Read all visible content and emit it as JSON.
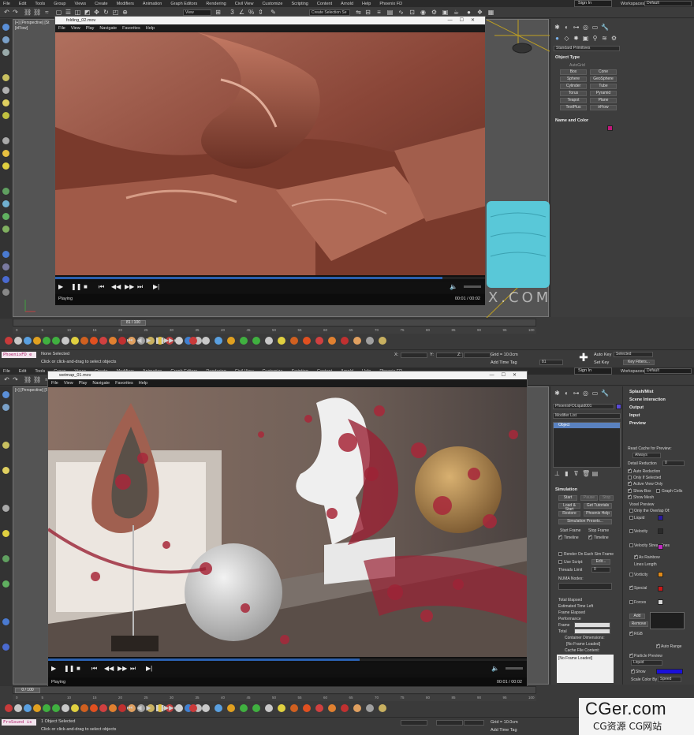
{
  "menu": [
    "File",
    "Edit",
    "Tools",
    "Group",
    "Views",
    "Create",
    "Modifiers",
    "Animation",
    "Graph Editors",
    "Rendering",
    "Civil View",
    "Customize",
    "Scripting",
    "Content",
    "Arnold",
    "Help",
    "Phoenix FD"
  ],
  "sign_in": "Sign In",
  "workspaces_label": "Workspaces:",
  "workspaces_value": "Default",
  "toolbar": {
    "view_select": "View",
    "selection_set": "Create Selection Se"
  },
  "pane1": {
    "viewport_label": "[+] [Perspective] [St",
    "viewport_label2": "[irFlow]",
    "watermark": "REDEFINEFX.COM",
    "player": {
      "title": "folding_02.mov",
      "menu": [
        "File",
        "View",
        "Play",
        "Navigate",
        "Favorites",
        "Help"
      ],
      "status": "Playing",
      "time": "00:01 / 00:02",
      "progress": 0.9
    },
    "command_panel": {
      "dropdown": "Standard Primitives",
      "object_type_header": "Object Type",
      "autogrid": "AutoGrid",
      "buttons": [
        "Box",
        "Cone",
        "Sphere",
        "GeoSphere",
        "Cylinder",
        "Tube",
        "Torus",
        "Pyramid",
        "Teapot",
        "Plane",
        "TextPlus",
        "irFlow"
      ],
      "name_color_header": "Name and Color",
      "color": "#c0187a"
    },
    "timeline": {
      "frame": "81 / 100"
    },
    "ruler": [
      "0",
      "5",
      "10",
      "15",
      "20",
      "25",
      "30",
      "35",
      "40",
      "45",
      "50",
      "55",
      "60",
      "65",
      "70",
      "75",
      "80",
      "85",
      "90",
      "95",
      "100"
    ],
    "status": {
      "maxscript": "PhoenixFD e",
      "line1": "None Selected",
      "line2": "Click or click-and-drag to select objects",
      "x_label": "X:",
      "y_label": "Y:",
      "z_label": "Z:",
      "grid": "Grid = 10.0cm",
      "add_time_tag": "Add Time Tag",
      "auto_key": "Auto Key",
      "selected": "Selected",
      "set_key": "Set Key",
      "key_filters": "Key Filters...",
      "frame_field": "81"
    }
  },
  "pane2": {
    "viewport_label": "[+] [Perspective] [St",
    "player": {
      "title": "wetmap_01.mov",
      "menu": [
        "File",
        "View",
        "Play",
        "Navigate",
        "Favorites",
        "Help"
      ],
      "status": "Playing",
      "time": "00:01 / 00:02",
      "progress": 0.65
    },
    "command_panel": {
      "object_name": "PhoenixFDLiquid001",
      "modifier_list": "Modifier List",
      "stack_item": "Object",
      "simulation_header": "Simulation",
      "start": "Start",
      "pause": "Pause",
      "stop": "Stop",
      "load_start": "Load & Start",
      "get_tutorials": "Get Tutorials",
      "restore": "Restore",
      "phoenix_help": "Phoenix Help",
      "sim_presets": "Simulation Presets...",
      "start_frame": "Start Frame",
      "stop_frame": "Stop Frame",
      "timeline": "Timeline",
      "render_each": "Render On Each Sim Frame",
      "use_script": "Use Script:",
      "edit": "Edit...",
      "threads_limit": "Threads Limit",
      "threads_value": "0",
      "numa": "NUMA Nodes:",
      "total_elapsed": "Total Elapsed",
      "est_time": "Estimated Time Left",
      "frame_elapsed": "Frame Elapsed",
      "performance": "Performance",
      "frame": "Frame",
      "total": "Total",
      "container_dims": "Container Dimensions:",
      "no_frame": "[No Frame Loaded]",
      "cache_content": "Cache File Content:",
      "no_frame2": "[No Frame Loaded]",
      "rollouts": [
        "Splash/Mist",
        "Scene Interaction",
        "Output",
        "Input",
        "Preview"
      ],
      "read_cache": "Read Cache for Preview:",
      "always": "Always",
      "detail_reduction": "Detail Reduction",
      "detail_value": "0",
      "auto_reduction": "Auto Reduction",
      "only_selected": "Only If Selected",
      "active_view": "Active View Only",
      "show_box": "Show Box",
      "graph_cells": "Graph Cells",
      "show_mesh": "Show Mesh",
      "voxel_preview": "Voxel Preview",
      "only_overlap": "Only the Overlap Of:",
      "liquid": "Liquid",
      "velocity": "Velocity",
      "velocity_streamlines": "Velocity Streamlines",
      "as_rainbow": "As Rainbow",
      "lines_length": "Lines Length",
      "vorticity": "Vorticity",
      "special": "Special",
      "forces": "Forces",
      "add": "Add",
      "remove": "Remove",
      "rgb": "RGB",
      "auto_range": "Auto Range",
      "particle_preview": "Particle Preview",
      "particle_type": "Liquid",
      "show": "Show",
      "scale_color_by": "Scale Color By",
      "scale_value": "Speed"
    },
    "timeline": {
      "frame": "0 / 100"
    },
    "status": {
      "maxscript": "FroSound is",
      "line1": "1 Object Selected",
      "line2": "Click or click-and-drag to select objects",
      "grid": "Grid = 10.0cm",
      "add_time_tag": "Add Time Tag"
    }
  },
  "logo": {
    "big": "CGer.com",
    "small": "CG资源 CG网站"
  }
}
